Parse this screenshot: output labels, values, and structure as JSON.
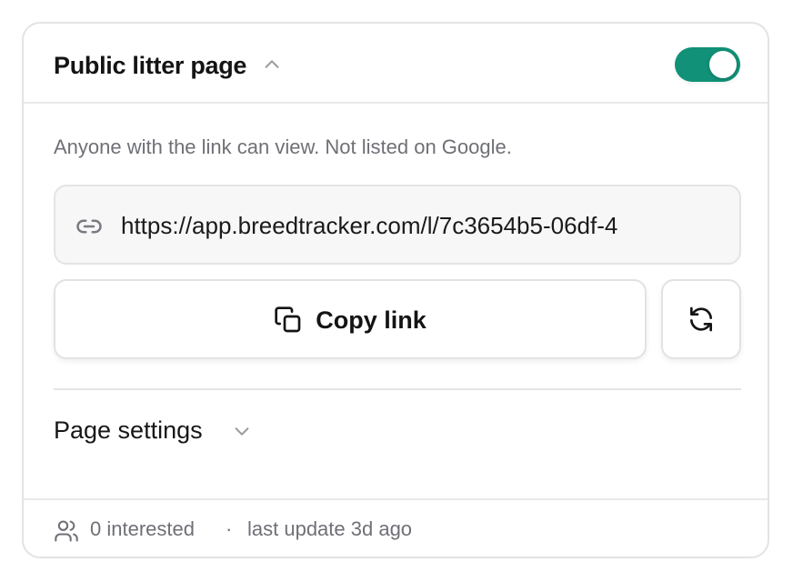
{
  "header": {
    "title": "Public litter page",
    "collapsed": false,
    "public_enabled": true
  },
  "colors": {
    "toggle_on": "#119177",
    "muted_text": "#6f7076",
    "border": "#e3e3e6"
  },
  "description": "Anyone with the link can view. Not listed on Google.",
  "share_link": {
    "icon": "link-icon",
    "url": "https://app.breedtracker.com/l/7c3654b5-06df-4"
  },
  "actions": {
    "copy_label": "Copy link",
    "copy_icon": "copy-icon",
    "refresh_icon": "refresh-icon"
  },
  "settings": {
    "label": "Page settings",
    "expanded": false
  },
  "footer": {
    "icon": "users-icon",
    "interested": "0 interested",
    "separator": "·",
    "last_update": "last update 3d ago"
  }
}
